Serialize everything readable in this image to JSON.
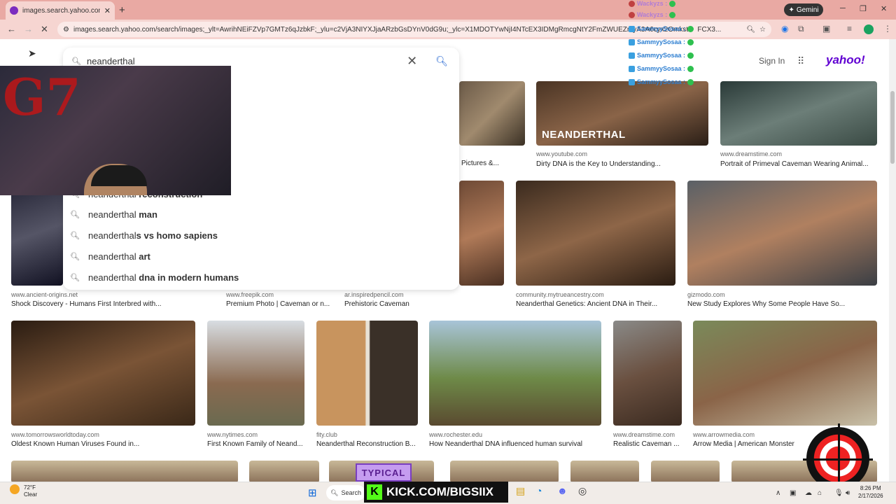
{
  "browser": {
    "tab_title": "images.search.yahoo.com/sear",
    "tab_close": "✕",
    "new_tab": "+",
    "gemini_label": "Gemini",
    "url": "images.search.yahoo.com/search/images;_ylt=AwrihNEiFZVp7GMTz6qJzbkF;_ylu=c2VjA3NIYXJjaARzbGsDYnV0dG9u;_ylc=X1MDOTYwNjI4NTcEX3IDMgRmcgNtY2FmZWUEZnIyA3A6cyx2Omkstb",
    "url_tail": "FCX3..."
  },
  "header": {
    "sign_in": "Sign In",
    "logo": "yahoo!"
  },
  "search": {
    "query": "neanderthal",
    "suggestions": [
      {
        "prefix": "neanderthal ",
        "bold": "reconstruction"
      },
      {
        "prefix": "neanderthal ",
        "bold": "man"
      },
      {
        "prefix": "neanderthal",
        "bold": "s vs homo sapiens"
      },
      {
        "prefix": "neanderthal ",
        "bold": "art"
      },
      {
        "prefix": "neanderthal ",
        "bold": "dna in modern humans"
      }
    ]
  },
  "results": [
    {
      "source": "",
      "caption": "Pictures &..."
    },
    {
      "source": "www.youtube.com",
      "caption": "Dirty DNA is the Key to Understanding...",
      "label": "NEANDERTHAL"
    },
    {
      "source": "www.dreamstime.com",
      "caption": "Portrait of Primeval Caveman Wearing Animal..."
    },
    {
      "source": "www.ancient-origins.net",
      "caption": "Shock Discovery - Humans First Interbred with..."
    },
    {
      "source": "www.freepik.com",
      "caption": "Premium Photo | Caveman or n..."
    },
    {
      "source": "ar.inspiredpencil.com",
      "caption": "Prehistoric Caveman"
    },
    {
      "source": "community.mytrueancestry.com",
      "caption": "Neanderthal Genetics: Ancient DNA in Their..."
    },
    {
      "source": "gizmodo.com",
      "caption": "New Study Explores Why Some People Have So..."
    },
    {
      "source": "www.tomorrowsworldtoday.com",
      "caption": "Oldest Known Human Viruses Found in..."
    },
    {
      "source": "www.nytimes.com",
      "caption": "First Known Family of Neand..."
    },
    {
      "source": "fity.club",
      "caption": "Neanderthal Reconstruction B..."
    },
    {
      "source": "www.rochester.edu",
      "caption": "How Neanderthal DNA influenced human survival"
    },
    {
      "source": "www.dreamstime.com",
      "caption": "Realistic Caveman ..."
    },
    {
      "source": "www.arrowmedia.com",
      "caption": "Arrow Media | American Monster"
    }
  ],
  "overlay": {
    "cam_logo": "G7",
    "chat": [
      {
        "name": "Wackyzs :",
        "type": "w"
      },
      {
        "name": "Wackyzs :",
        "type": "w"
      },
      {
        "name": "SammyySosaa :",
        "type": "s"
      },
      {
        "name": "SammyySosaa :",
        "type": "s"
      },
      {
        "name": "SammyySosaa :",
        "type": "s"
      },
      {
        "name": "SammyySosaa :",
        "type": "s"
      },
      {
        "name": "SammyySosaa :",
        "type": "s"
      }
    ],
    "typical": "TYPICAL",
    "kick": "KICK.COM/BIGSIIX"
  },
  "taskbar": {
    "temp": "72°F",
    "weather": "Clear",
    "search": "Search",
    "time": "8:26 PM",
    "date": "2/17/2026"
  }
}
